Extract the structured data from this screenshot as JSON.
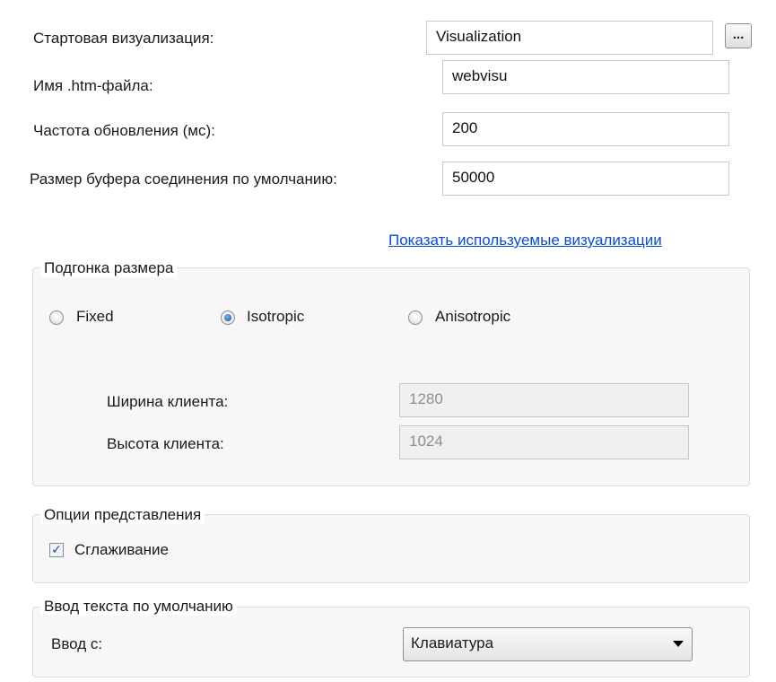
{
  "general": {
    "start_visu_label": "Стартовая визуализация:",
    "start_visu_value": "Visualization",
    "browse_label": "...",
    "htm_name_label": "Имя .htm-файла:",
    "htm_name_value": "webvisu",
    "refresh_label": "Частота обновления (мс):",
    "refresh_value": "200",
    "buffer_label": "Размер буфера соединения по умолчанию:",
    "buffer_value": "50000",
    "show_used_link": "Показать используемые визуализации"
  },
  "scaling": {
    "title": "Подгонка размера",
    "options": [
      "Fixed",
      "Isotropic",
      "Anisotropic"
    ],
    "selected": "Isotropic",
    "client_width_label": "Ширина клиента:",
    "client_width_value": "1280",
    "client_height_label": "Высота клиента:",
    "client_height_value": "1024"
  },
  "presentation": {
    "title": "Опции представления",
    "antialiasing_label": "Сглаживание",
    "antialiasing_checked": true
  },
  "text_input": {
    "title": "Ввод текста по умолчанию",
    "input_label": "Ввод с:",
    "input_value": "Клавиатура"
  }
}
